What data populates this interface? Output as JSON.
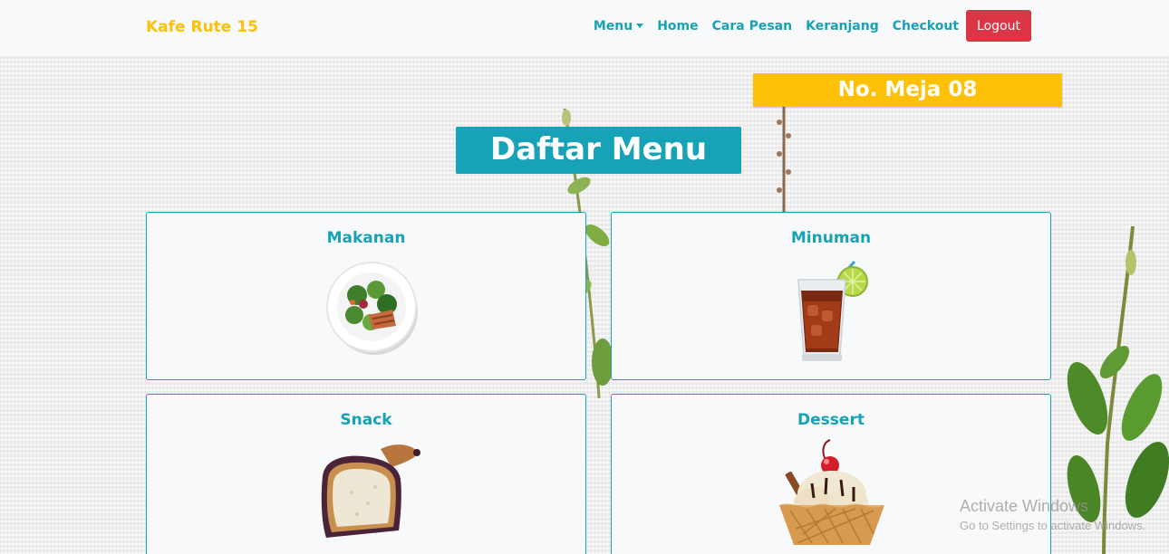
{
  "navbar": {
    "brand": "Kafe Rute 15",
    "menu_label": "Menu",
    "home_label": "Home",
    "cara_pesan_label": "Cara Pesan",
    "keranjang_label": "Keranjang",
    "checkout_label": "Checkout",
    "logout_label": "Logout"
  },
  "table_badge": "No. Meja 08",
  "page_title": "Daftar Menu",
  "categories": [
    {
      "label": "Makanan",
      "icon": "salad-plate-icon"
    },
    {
      "label": "Minuman",
      "icon": "iced-drink-icon"
    },
    {
      "label": "Snack",
      "icon": "toast-bread-icon"
    },
    {
      "label": "Dessert",
      "icon": "ice-cream-cup-icon"
    }
  ],
  "watermark": {
    "line1": "Activate Windows",
    "line2": "Go to Settings to activate Windows."
  },
  "colors": {
    "accent": "#17a2b8",
    "brand": "#ffc107",
    "danger": "#dc3545",
    "card_bg": "#f8f9fa"
  }
}
